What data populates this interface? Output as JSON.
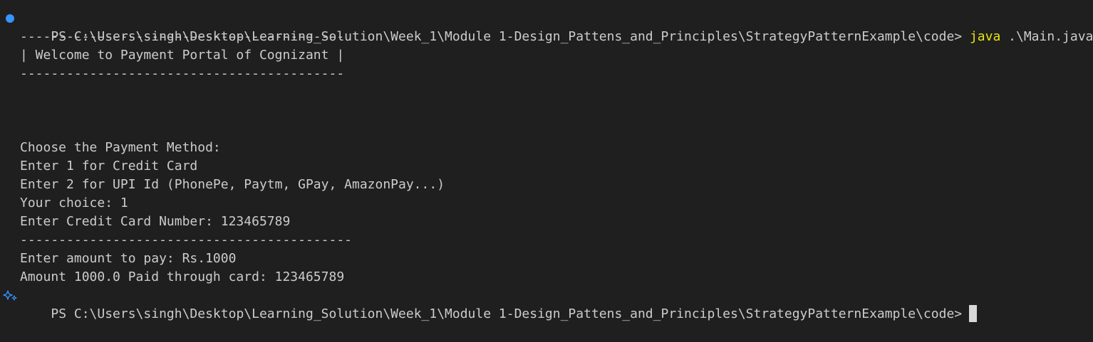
{
  "terminal": {
    "prompt": "PS C:\\Users\\singh\\Desktop\\Learning_Solution\\Week_1\\Module 1-Design_Pattens_and_Principles\\StrategyPatternExample\\code>",
    "command_name": "java",
    "command_arg": ".\\Main.java",
    "lines": [
      "------------------------------------------",
      "| Welcome to Payment Portal of Cognizant |",
      "------------------------------------------",
      "",
      "",
      "",
      "Choose the Payment Method:",
      "Enter 1 for Credit Card",
      "Enter 2 for UPI Id (PhonePe, Paytm, GPay, AmazonPay...)",
      "Your choice: 1",
      "Enter Credit Card Number: 123465789",
      "-------------------------------------------",
      "Enter amount to pay: Rs.1000",
      "Amount 1000.0 Paid through card: 123465789"
    ],
    "final_prompt": "PS C:\\Users\\singh\\Desktop\\Learning_Solution\\Week_1\\Module 1-Design_Pattens_and_Principles\\StrategyPatternExample\\code>"
  },
  "icons": {
    "status_dot": "circle-dot-icon",
    "sparkle": "sparkle-icon"
  },
  "colors": {
    "background": "#1f1f1f",
    "text": "#cccccc",
    "command": "#e5e510",
    "dot": "#3794ff"
  }
}
